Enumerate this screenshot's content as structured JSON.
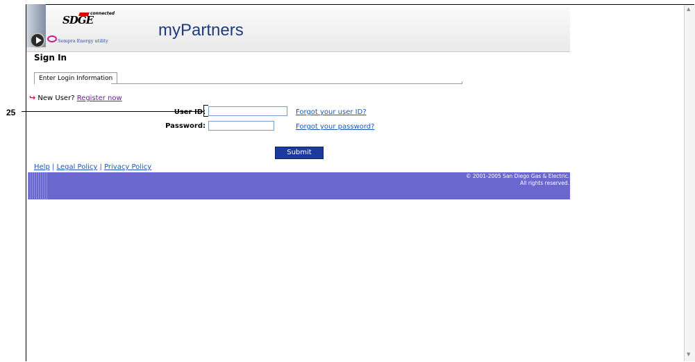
{
  "header": {
    "logo_text": "SDGE",
    "logo_connected": "connected",
    "logo_sempra": "Sempra Energy utility",
    "app_title": "myPartners"
  },
  "page": {
    "heading": "Sign In",
    "tab_label": "Enter Login Information"
  },
  "new_user": {
    "text": "New User?",
    "register_link": "Register now"
  },
  "form": {
    "user_id_label": "User ID:",
    "user_id_value": "",
    "forgot_user_id": "Forgot your user ID?",
    "password_label": "Password:",
    "password_value": "",
    "forgot_password": "Forgot your password?",
    "submit_label": "Submit"
  },
  "callout": {
    "number": "25"
  },
  "footer": {
    "help": "Help",
    "legal": "Legal Policy",
    "privacy": "Privacy Policy",
    "separator": "|",
    "copyright_line1": "© 2001-2005 San Diego Gas & Electric.",
    "copyright_line2": "All rights reserved."
  },
  "colors": {
    "title_blue": "#1e3c7d",
    "link_blue": "#1a56b4",
    "submit_blue": "#1c3a9e",
    "footer_purple": "#6a68cf",
    "register_purple": "#6a1f8a"
  }
}
